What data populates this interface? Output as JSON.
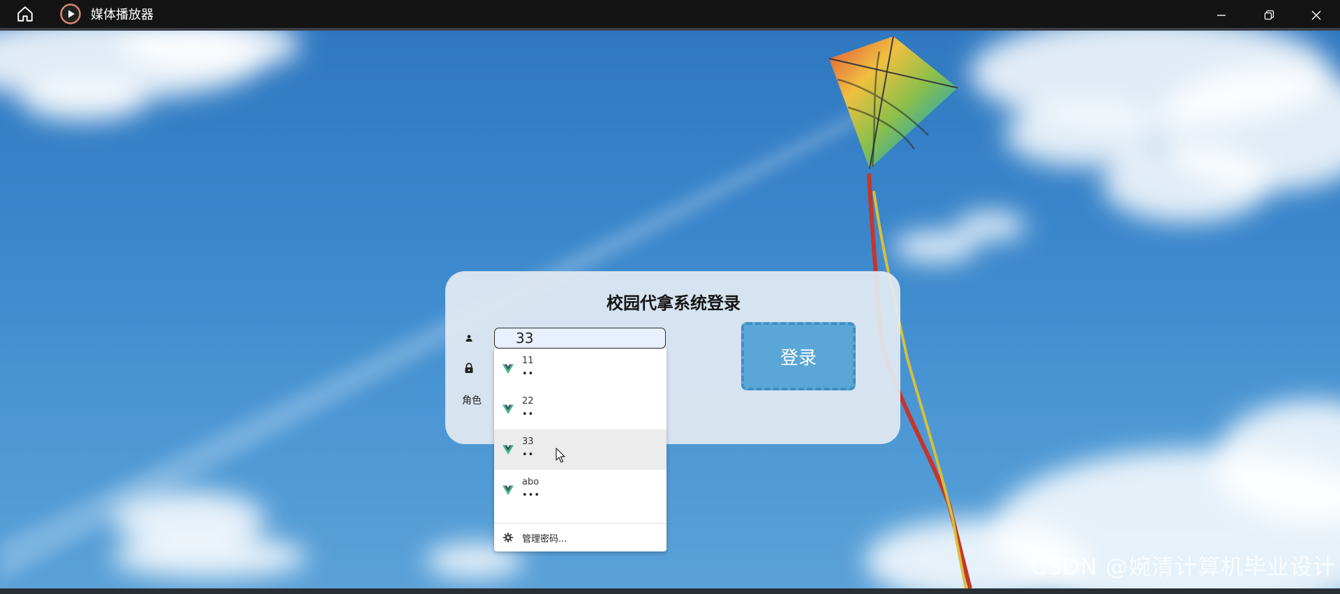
{
  "window": {
    "title": "媒体播放器",
    "icons": {
      "home": "home-icon",
      "app": "play-circle-icon",
      "minimize": "minimize-icon",
      "restore": "restore-icon",
      "close": "close-icon"
    }
  },
  "login": {
    "title": "校园代拿系统登录",
    "username_value": "33",
    "role_label": "角色",
    "login_button": "登录",
    "icons": {
      "username": "user-icon",
      "password": "lock-icon"
    }
  },
  "autofill": {
    "items": [
      {
        "username": "11",
        "password": "••",
        "icon": "vue-logo-icon"
      },
      {
        "username": "22",
        "password": "••",
        "icon": "vue-logo-icon"
      },
      {
        "username": "33",
        "password": "••",
        "icon": "vue-logo-icon"
      },
      {
        "username": "abo",
        "password": "•••",
        "icon": "vue-logo-icon"
      }
    ],
    "hovered_index": 2,
    "manage_label": "管理密码...",
    "manage_icon": "gear-icon"
  },
  "watermark": "CSDN @婉清计算机毕业设计",
  "colors": {
    "titlebar": "#141414",
    "login_button": "#5aa6d6",
    "card": "#e2eaf2"
  }
}
